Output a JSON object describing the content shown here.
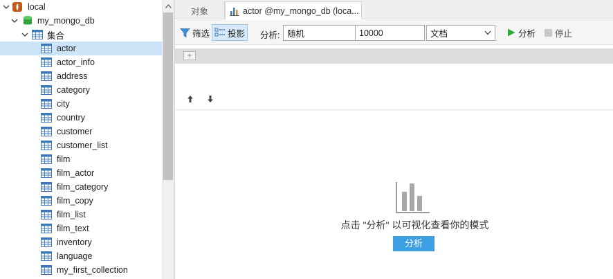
{
  "tree": {
    "connection": "local",
    "database": "my_mongo_db",
    "group": "集合",
    "collections": [
      "actor",
      "actor_info",
      "address",
      "category",
      "city",
      "country",
      "customer",
      "customer_list",
      "film",
      "film_actor",
      "film_category",
      "film_copy",
      "film_list",
      "film_text",
      "inventory",
      "language",
      "my_first_collection"
    ]
  },
  "tabs": {
    "objects": "对象",
    "actor": "actor @my_mongo_db (loca..."
  },
  "toolbar": {
    "filter": "筛选",
    "projection": "投影",
    "analyze_label": "分析:",
    "mode": "随机",
    "count": "10000",
    "type": "文档",
    "run": "分析",
    "stop": "停止"
  },
  "filter": {
    "add": "+"
  },
  "empty_state": {
    "hint": "点击 \"分析\" 以可视化查看你的模式",
    "button": "分析"
  },
  "colors": {
    "accent": "#3ea0e4",
    "selected_row": "#cce4f7",
    "run_green": "#2eaa3a"
  }
}
